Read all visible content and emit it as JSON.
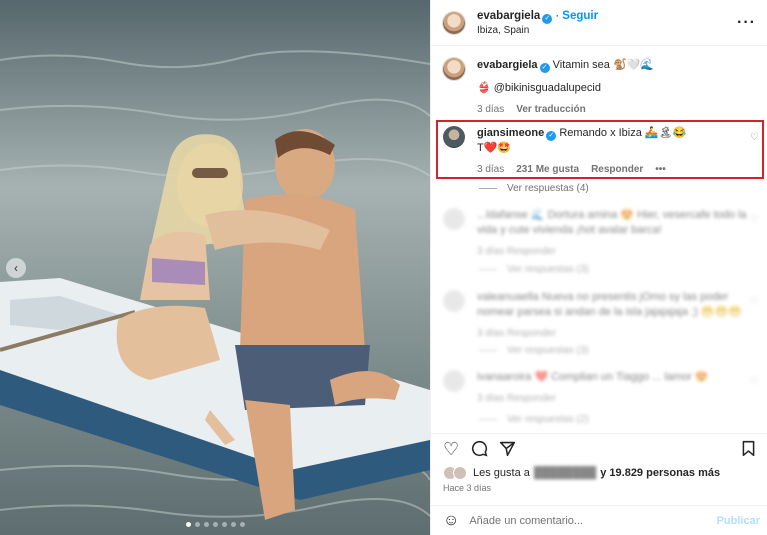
{
  "post": {
    "author": "evabargiela",
    "follow_label": "Seguir",
    "location": "Ibiza, Spain",
    "more_icon": "more-horizontal-icon"
  },
  "caption": {
    "author": "evabargiela",
    "text": "Vitamin sea 🐒🤍🌊",
    "tag": "👙 @bikinisguadalupecid",
    "age": "3 días",
    "translate_label": "Ver traducción"
  },
  "highlighted_comment": {
    "author": "giansimeone",
    "text_line1": "Remando x Ibiza 🚣🏝😂",
    "text_line2": "T❤️🤩",
    "age": "3 días",
    "likes": "231 Me gusta",
    "reply_label": "Responder",
    "more_label": "•••",
    "highlight_color": "#d1232a"
  },
  "view_replies_label": "Ver respuestas (4)",
  "blurred_comments": [
    {
      "text": "...ldafanse 🌊 Dortura amina 😍 Hier, vesercafe todo la vida y cute vivienda ¡hot avalar barca!",
      "meta": "3 días   Responder",
      "replies": "Ver respuestas (3)"
    },
    {
      "text": "valeanuaella Nueva no presentis jOmo sy las poder nomear parsea si andan de la isla jajajajaja ;) 😁😁😁",
      "meta": "3 días   Responder",
      "replies": "Ver respuestas (3)"
    },
    {
      "text": "ivanaaroira ❤️ Complian un Tiaggo ... lamor 😍",
      "meta": "3 días   Responder",
      "replies": "Ver respuestas (2)"
    }
  ],
  "likes": {
    "prefix": "Les gusta a",
    "suffix": "y 19.829 personas más"
  },
  "time_label": "Hace 3 días",
  "add_comment": {
    "placeholder": "Añade un comentario...",
    "publish_label": "Publicar"
  },
  "colors": {
    "accent": "#0095f6",
    "verified": "#1d9bf0"
  }
}
